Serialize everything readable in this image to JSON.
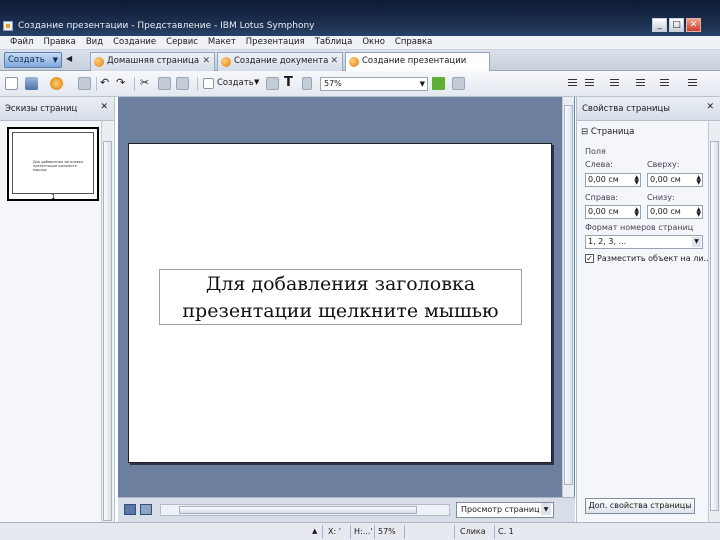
{
  "window": {
    "title": "Создание презентации - Представление - IBM Lotus Symphony",
    "buttons": {
      "minimize": "_",
      "maximize": "□",
      "close": "✕"
    }
  },
  "menu": [
    "Файл",
    "Правка",
    "Вид",
    "Создание",
    "Сервис",
    "Макет",
    "Презентация",
    "Таблица",
    "Окно",
    "Справка"
  ],
  "tabbar": {
    "new_button": "Создать",
    "tabs": [
      {
        "label": "Домашняя страница",
        "active": false
      },
      {
        "label": "Создание документа",
        "active": false
      },
      {
        "label": "Создание презентации",
        "active": true
      }
    ]
  },
  "toolbar": {
    "create_label": "Создать",
    "zoom": "57%",
    "text_tool": "T"
  },
  "left_panel": {
    "title": "Эскизы страниц",
    "thumbnail_text": "Для добавления заголовка презентации щелкните мышью",
    "slide_number": "1"
  },
  "slide": {
    "title_placeholder": "Для добавления заголовка презентации щелкните мышью"
  },
  "view_selector": "Просмотр страниц",
  "right_panel": {
    "title": "Свойства страницы",
    "section": "Страница",
    "group": "Поля",
    "left_label": "Слева:",
    "left_value": "0,00 см",
    "top_label": "Сверху:",
    "top_value": "0,00 см",
    "right_label": "Справа:",
    "right_value": "0,00 см",
    "bottom_label": "Снизу:",
    "bottom_value": "0,00 см",
    "numbering_label": "Формат номеров страниц",
    "numbering_value": "1, 2, 3, ...",
    "fit_checkbox_label": "Разместить объект на ли...",
    "fit_checked": true,
    "more_button": "Доп. свойства страницы"
  },
  "statusbar": {
    "x": "X: '",
    "h": "H:...'",
    "zoom": "57%",
    "layer": "Слика",
    "page": "C. 1"
  },
  "colors": {
    "titlebar": "#1d3152",
    "canvas": "#6d7f9e",
    "accent_button": "#7fa6da"
  }
}
